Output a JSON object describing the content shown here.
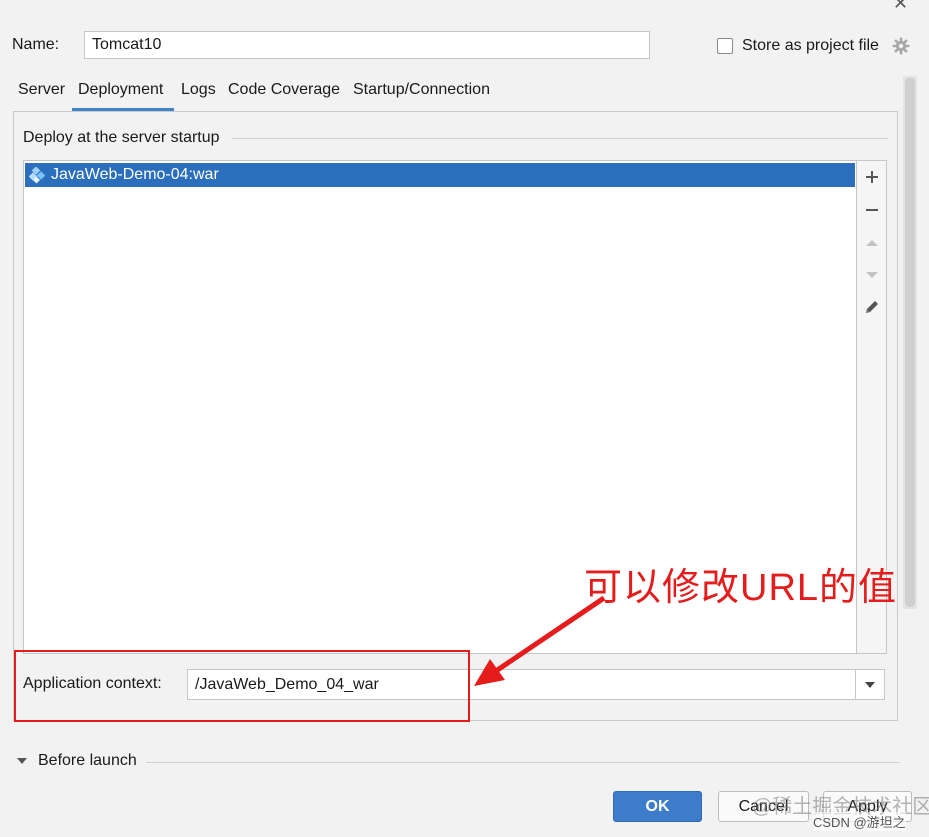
{
  "form": {
    "name_label": "Name:",
    "name_value": "Tomcat10",
    "store_label": "Store as project file",
    "store_checked": false
  },
  "tabs": [
    {
      "label": "Server"
    },
    {
      "label": "Deployment",
      "active": true
    },
    {
      "label": "Logs"
    },
    {
      "label": "Code Coverage"
    },
    {
      "label": "Startup/Connection"
    }
  ],
  "deploy": {
    "group_title": "Deploy at the server startup",
    "items": [
      {
        "label": "JavaWeb-Demo-04:war",
        "selected": true
      }
    ],
    "toolbar": [
      "add-icon",
      "remove-icon",
      "move-up-icon",
      "move-down-icon",
      "edit-pencil-icon"
    ]
  },
  "context": {
    "label": "Application context:",
    "value": "/JavaWeb_Demo_04_war"
  },
  "annotation": {
    "text": "可以修改URL的值",
    "color": "#e41c1c"
  },
  "before_launch": {
    "label": "Before launch"
  },
  "buttons": {
    "ok": "OK",
    "cancel": "Cancel",
    "apply": "Apply"
  },
  "watermark": {
    "line1": "@稀土掘金技术社区",
    "line2": "CSDN @游坦之"
  },
  "colors": {
    "accent": "#4083c9",
    "selection": "#2b6fbc",
    "primary_button": "#3d7ccb"
  }
}
